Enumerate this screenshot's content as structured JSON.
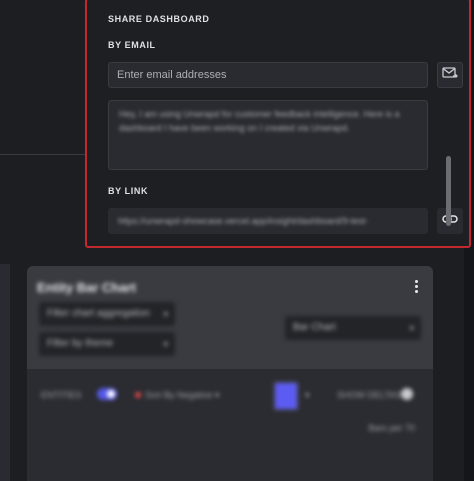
{
  "share": {
    "title": "SHARE DASHBOARD",
    "by_email_label": "BY EMAIL",
    "email_placeholder": "Enter email addresses",
    "message_text": "Hey, I am using Unwrapd for customer feedback intelligence. Here is a dashboard I have been working on I created via Unwrapd.",
    "by_link_label": "BY LINK",
    "link_url": "https://unwrapd-showcase.vercel.app/insight/dashboard/9-test-",
    "icons": {
      "send": "mail-send-icon",
      "copy": "link-icon"
    },
    "accent_color": "#c2292e"
  },
  "background": {
    "chart_title": "Entity Bar Chart",
    "filter_agg": "Filter chart aggregation",
    "filter_group": "Filter by theme",
    "chart_type": "Bar Chart",
    "toolbar": {
      "label_a": "ENTITIES",
      "sort_label": "Sort By Negative",
      "label_b": "SHOW DELTAS"
    },
    "bar_label": "Bars per 70"
  }
}
